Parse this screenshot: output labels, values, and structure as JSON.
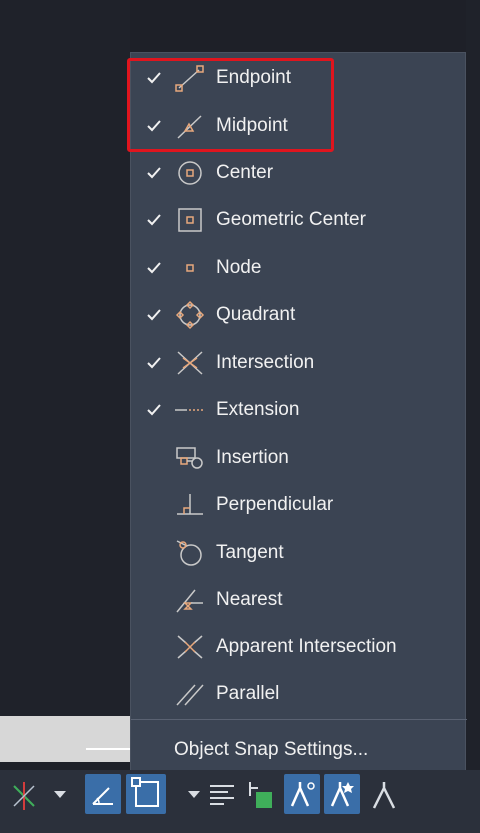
{
  "snap_menu": {
    "items": [
      {
        "label": "Endpoint",
        "checked": true,
        "icon": "endpoint-icon"
      },
      {
        "label": "Midpoint",
        "checked": true,
        "icon": "midpoint-icon"
      },
      {
        "label": "Center",
        "checked": true,
        "icon": "center-icon"
      },
      {
        "label": "Geometric Center",
        "checked": true,
        "icon": "geometric-center-icon"
      },
      {
        "label": "Node",
        "checked": true,
        "icon": "node-icon"
      },
      {
        "label": "Quadrant",
        "checked": true,
        "icon": "quadrant-icon"
      },
      {
        "label": "Intersection",
        "checked": true,
        "icon": "intersection-icon"
      },
      {
        "label": "Extension",
        "checked": true,
        "icon": "extension-icon"
      },
      {
        "label": "Insertion",
        "checked": false,
        "icon": "insertion-icon"
      },
      {
        "label": "Perpendicular",
        "checked": false,
        "icon": "perpendicular-icon"
      },
      {
        "label": "Tangent",
        "checked": false,
        "icon": "tangent-icon"
      },
      {
        "label": "Nearest",
        "checked": false,
        "icon": "nearest-icon"
      },
      {
        "label": "Apparent Intersection",
        "checked": false,
        "icon": "apparent-intersection-icon"
      },
      {
        "label": "Parallel",
        "checked": false,
        "icon": "parallel-icon"
      }
    ],
    "settings_label": "Object Snap Settings..."
  },
  "colors": {
    "menu_bg": "#3b4453",
    "text": "#f1f1f1",
    "snap_marker": "#e8a87c",
    "highlight": "#e0151e",
    "active_button": "#3a6ea8"
  },
  "statusbar": {
    "icons": [
      "polar-tracking-icon",
      "dropdown-arrow-icon",
      "isometric-drafting-icon",
      "object-snap-icon",
      "dropdown-arrow-icon",
      "lineweight-icon",
      "transparency-icon",
      "annotation-scale-icon",
      "annotation-visibility-icon",
      "annotation-monitor-icon"
    ]
  }
}
